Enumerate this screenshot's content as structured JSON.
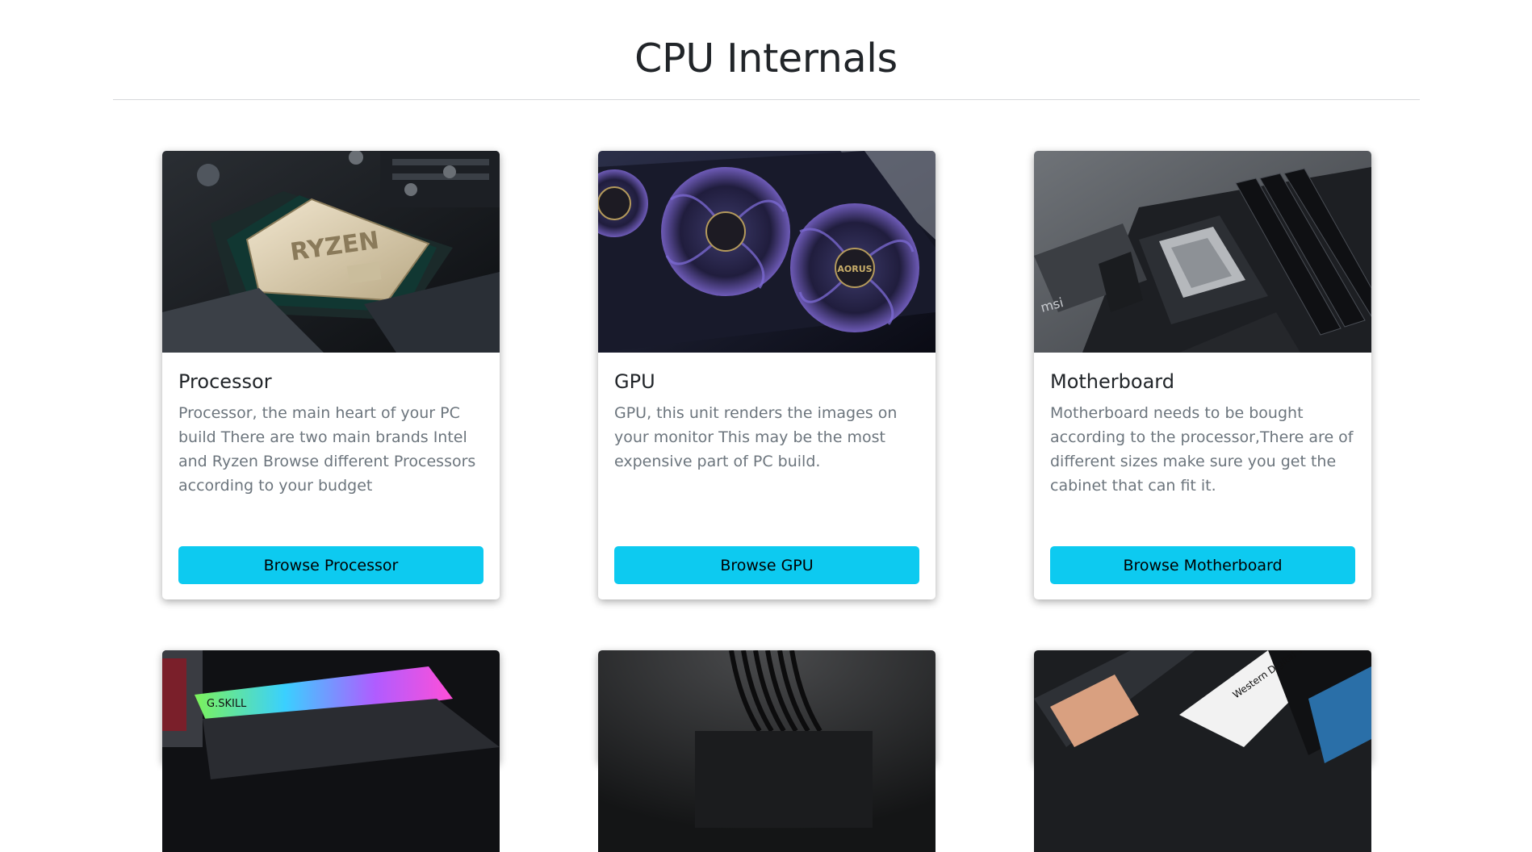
{
  "page": {
    "title": "CPU Internals"
  },
  "cards": [
    {
      "title": "Processor",
      "text": "Processor, the main heart of your PC build There are two main brands Intel and Ryzen Browse different Processors according to your budget",
      "button": "Browse Processor",
      "image_label": "RYZEN"
    },
    {
      "title": "GPU",
      "text": "GPU, this unit renders the images on your monitor This may be the most expensive part of PC build.",
      "button": "Browse GPU",
      "image_label": "AORUS"
    },
    {
      "title": "Motherboard",
      "text": "Motherboard needs to be bought according to the processor,There are of different sizes make sure you get the cabinet that can fit it.",
      "button": "Browse Motherboard",
      "image_label": "msi"
    }
  ],
  "lower_cards": [
    {
      "image_label": "G.SKILL"
    },
    {
      "image_label": ""
    },
    {
      "image_label": "Western Digital WD BLACK"
    }
  ],
  "colors": {
    "button": "#0dcaf0",
    "muted_text": "#6c757d"
  }
}
